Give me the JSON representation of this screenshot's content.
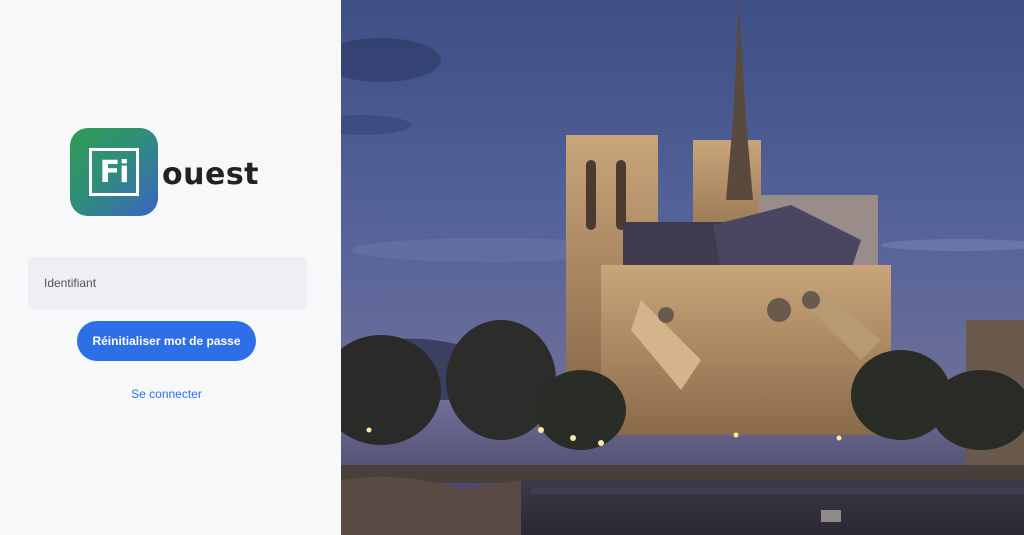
{
  "brand": {
    "logo_mark_text": "Fi",
    "wordmark": "ouest"
  },
  "form": {
    "identifier_placeholder": "Identifiant",
    "identifier_value": "",
    "reset_button_label": "Réinitialiser mot de passe",
    "login_link_label": "Se connecter"
  },
  "colors": {
    "accent": "#2e6fe8",
    "panel_background": "#f7f8fa",
    "input_background": "#eeeff2",
    "logo_gradient_start": "#2f9b52",
    "logo_gradient_end": "#3a63c4"
  },
  "background_image": {
    "subject": "Notre-Dame cathedral at dusk"
  }
}
